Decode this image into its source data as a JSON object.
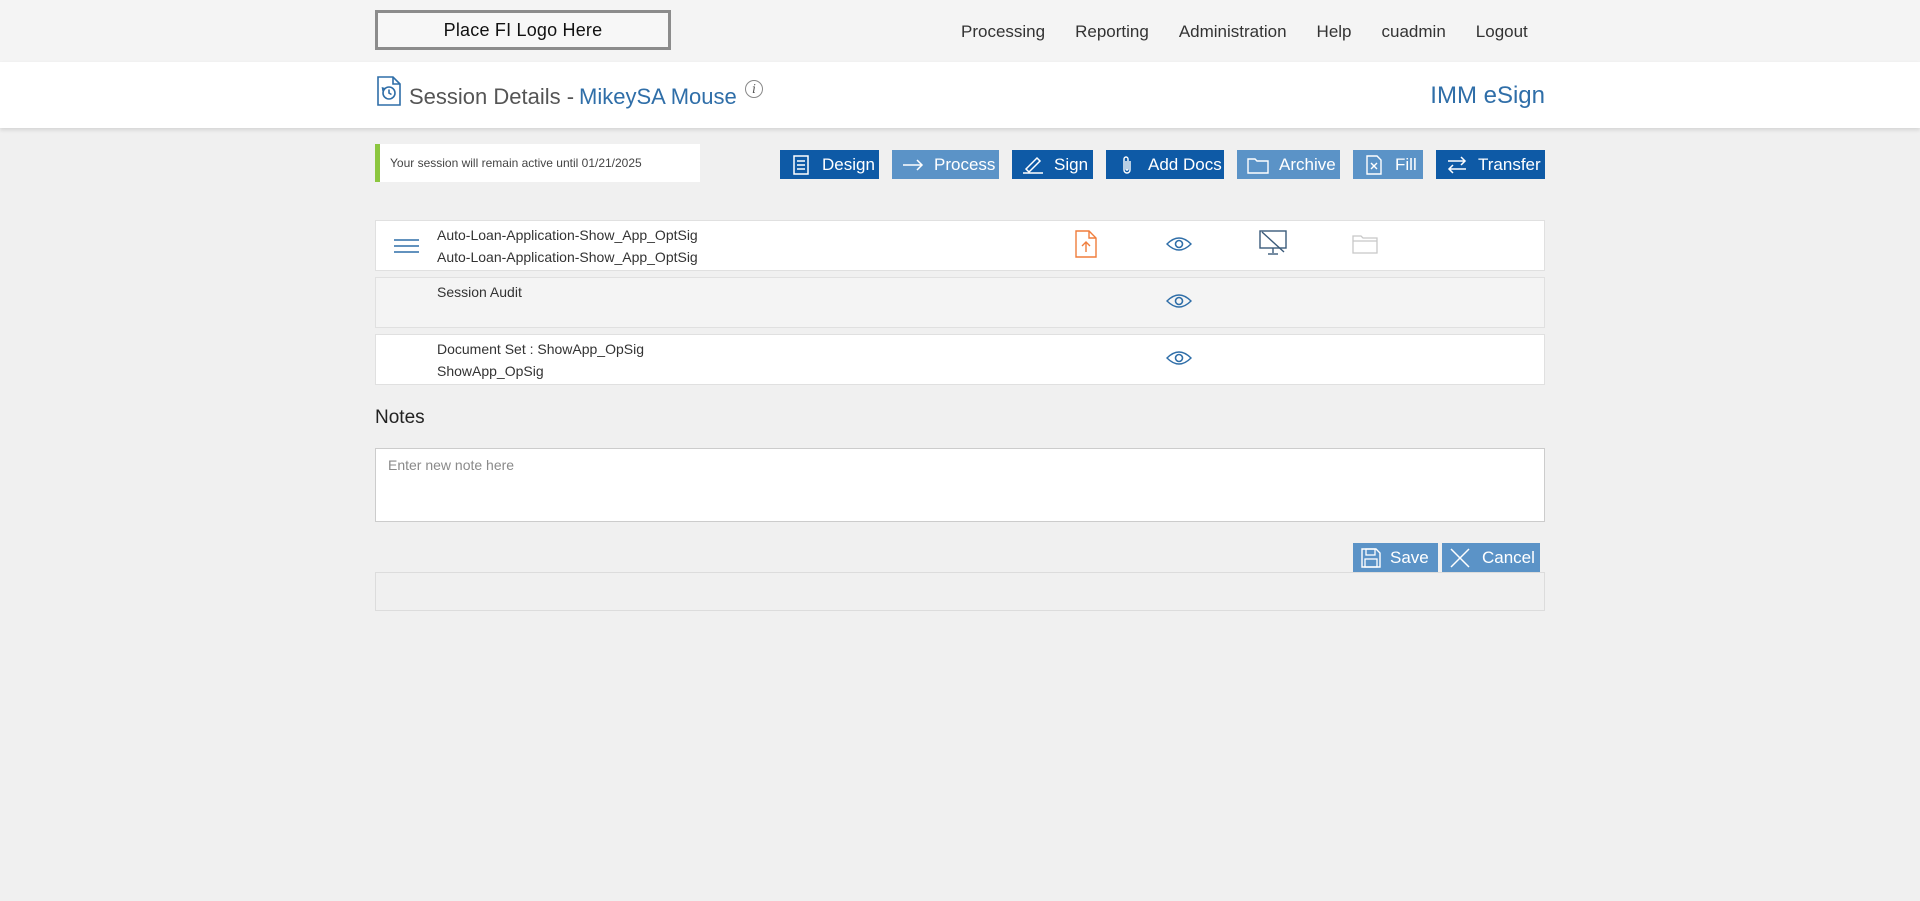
{
  "logo": {
    "text": "Place FI Logo Here"
  },
  "nav": {
    "items": [
      "Processing",
      "Reporting",
      "Administration",
      "Help",
      "cuadmin",
      "Logout"
    ]
  },
  "header": {
    "title": "Session Details -",
    "customer_name": "MikeySA Mouse",
    "info_glyph": "i",
    "brand": "IMM eSign"
  },
  "notice": {
    "text": "Your session will remain active until 01/21/2025"
  },
  "toolbar": {
    "design": "Design",
    "process": "Process",
    "sign": "Sign",
    "add_docs": "Add Docs",
    "archive": "Archive",
    "fill": "Fill",
    "transfer": "Transfer"
  },
  "rows": [
    {
      "line1": "Auto-Loan-Application-Show_App_OptSig",
      "line2": "Auto-Loan-Application-Show_App_OptSig"
    },
    {
      "line1": "Session Audit",
      "line2": ""
    },
    {
      "line1": "Document Set : ShowApp_OpSig",
      "line2": "ShowApp_OpSig"
    }
  ],
  "notes": {
    "title": "Notes",
    "placeholder": "Enter new note here",
    "save": "Save",
    "cancel": "Cancel"
  },
  "colors": {
    "primary_dark": "#0e5aa6",
    "primary_light": "#5b93c7",
    "accent_link": "#2f6ea8",
    "notice_bar": "#8cc63f",
    "upload_icon": "#f07d3c"
  },
  "icons": [
    "session-history-icon",
    "info-icon",
    "design-icon",
    "process-arrow-icon",
    "sign-pen-icon",
    "paperclip-icon",
    "folder-icon",
    "fill-form-icon",
    "transfer-icon",
    "hamburger-icon",
    "upload-doc-icon",
    "eye-icon",
    "no-display-icon",
    "save-disk-icon",
    "close-x-icon"
  ]
}
